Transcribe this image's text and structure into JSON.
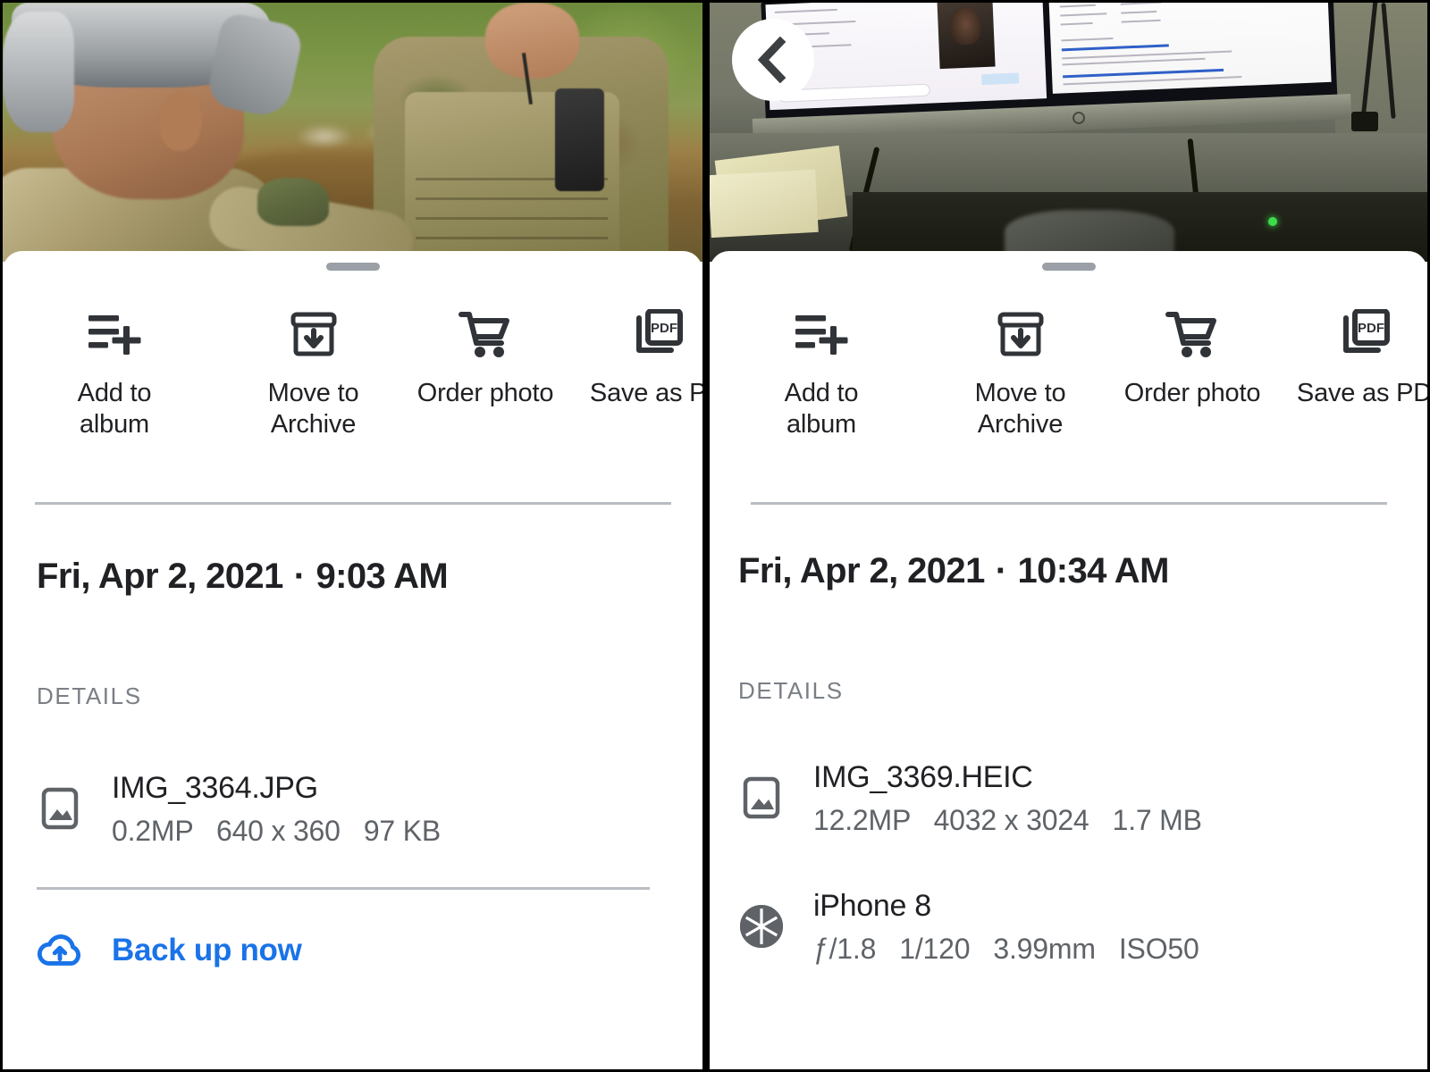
{
  "panels": [
    {
      "id": "left",
      "photo_alt": "Two soldiers in camouflage near a creek, one wearing an augmented reality headset",
      "has_back_button": false,
      "sheet": {
        "actions": [
          {
            "label": "Add to\nalbum",
            "icon": "add-to-album-icon"
          },
          {
            "label": "Move to\nArchive",
            "icon": "archive-icon"
          },
          {
            "label": "Order photo",
            "icon": "shopping-cart-icon"
          },
          {
            "label": "Save as PD",
            "icon": "save-as-pdf-icon"
          }
        ],
        "date": "Fri, Apr 2, 2021",
        "separator": "·",
        "time": "9:03 AM",
        "details_label": "DETAILS",
        "details": [
          {
            "icon": "image-file-icon",
            "title": "IMG_3364.JPG",
            "subtitle": "0.2MP   640 x 360   97 KB"
          }
        ],
        "backup": {
          "icon": "cloud-upload-icon",
          "label": "Back up now",
          "color": "#1a73e8"
        }
      }
    },
    {
      "id": "right",
      "photo_alt": "Desk with an HP widescreen monitor showing two browser windows, papers and cables below",
      "has_back_button": true,
      "back_button_icon": "chevron-left-icon",
      "sheet": {
        "actions": [
          {
            "label": "Add to\nalbum",
            "icon": "add-to-album-icon"
          },
          {
            "label": "Move to\nArchive",
            "icon": "archive-icon"
          },
          {
            "label": "Order photo",
            "icon": "shopping-cart-icon"
          },
          {
            "label": "Save as PD",
            "icon": "save-as-pdf-icon"
          }
        ],
        "date": "Fri, Apr 2, 2021",
        "separator": "·",
        "time": "10:34 AM",
        "details_label": "DETAILS",
        "details": [
          {
            "icon": "image-file-icon",
            "title": "IMG_3369.HEIC",
            "subtitle": "12.2MP   4032 x 3024   1.7 MB"
          },
          {
            "icon": "aperture-icon",
            "title": "iPhone 8",
            "subtitle": "ƒ/1.8   1/120   3.99mm   ISO50"
          }
        ]
      }
    }
  ],
  "colors": {
    "accent_blue": "#1a73e8",
    "text_primary": "#202124",
    "text_secondary": "#5f6368",
    "divider": "#b9bdc2",
    "handle": "#9aa0a6",
    "sheet_bg": "#ffffff"
  }
}
